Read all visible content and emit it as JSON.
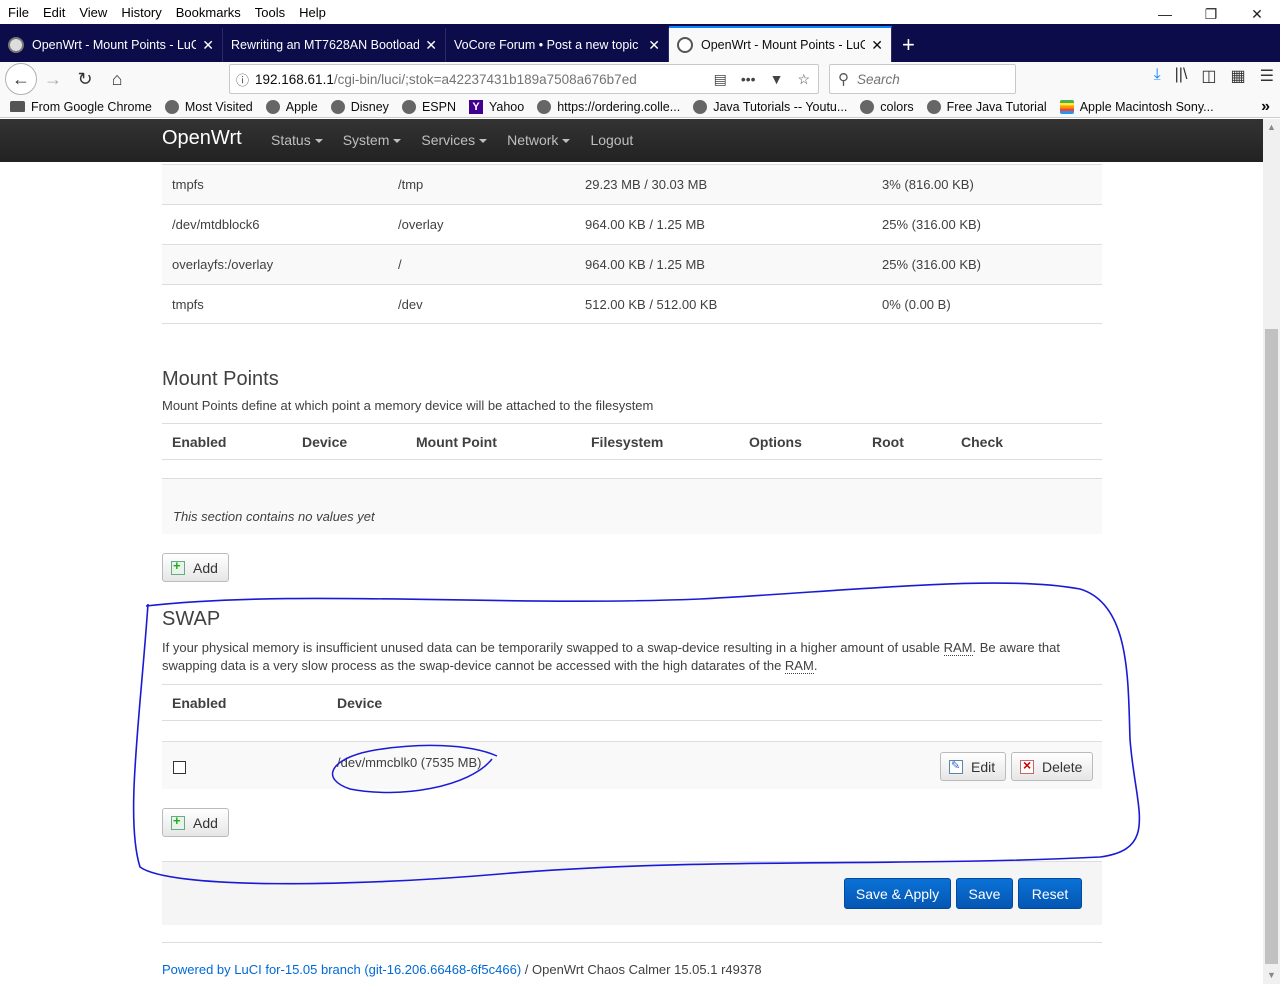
{
  "menubar": [
    "File",
    "Edit",
    "View",
    "History",
    "Bookmarks",
    "Tools",
    "Help"
  ],
  "tabs": [
    {
      "label": "OpenWrt - Mount Points - LuCI",
      "active": false
    },
    {
      "label": "Rewriting an MT7628AN Bootloader",
      "active": false
    },
    {
      "label": "VoCore Forum • Post a new topic",
      "active": false
    },
    {
      "label": "OpenWrt - Mount Points - LuCI",
      "active": true
    }
  ],
  "url": {
    "host": "192.168.61.1",
    "rest": "/cgi-bin/luci/;stok=a42237431b189a7508a676b7ed"
  },
  "search_placeholder": "Search",
  "bookmarks": [
    {
      "label": "From Google Chrome",
      "icon": "folder-icon"
    },
    {
      "label": "Most Visited",
      "icon": "gear-icon"
    },
    {
      "label": "Apple",
      "icon": "globe-icon"
    },
    {
      "label": "Disney",
      "icon": "globe-icon"
    },
    {
      "label": "ESPN",
      "icon": "globe-icon"
    },
    {
      "label": "Yahoo",
      "icon": "yahoo-icon"
    },
    {
      "label": "https://ordering.colle...",
      "icon": "globe-icon"
    },
    {
      "label": "Java Tutorials -- Youtu...",
      "icon": "globe-icon"
    },
    {
      "label": "colors",
      "icon": "globe-icon"
    },
    {
      "label": "Free Java Tutorial",
      "icon": "globe-icon"
    },
    {
      "label": "Apple Macintosh Sony...",
      "icon": "apple-icon"
    }
  ],
  "luci": {
    "brand": "OpenWrt",
    "nav": [
      "Status",
      "System",
      "Services",
      "Network",
      "Logout"
    ]
  },
  "mounted": [
    [
      "tmpfs",
      "/tmp",
      "29.23 MB / 30.03 MB",
      "3% (816.00 KB)"
    ],
    [
      "/dev/mtdblock6",
      "/overlay",
      "964.00 KB / 1.25 MB",
      "25% (316.00 KB)"
    ],
    [
      "overlayfs:/overlay",
      "/",
      "964.00 KB / 1.25 MB",
      "25% (316.00 KB)"
    ],
    [
      "tmpfs",
      "/dev",
      "512.00 KB / 512.00 KB",
      "0% (0.00 B)"
    ]
  ],
  "mount_points": {
    "title": "Mount Points",
    "desc": "Mount Points define at which point a memory device will be attached to the filesystem",
    "columns": [
      "Enabled",
      "Device",
      "Mount Point",
      "Filesystem",
      "Options",
      "Root",
      "Check"
    ],
    "empty": "This section contains no values yet",
    "add": "Add"
  },
  "swap": {
    "title": "SWAP",
    "desc1": "If your physical memory is insufficient unused data can be temporarily swapped to a swap-device resulting in a higher amount of usable ",
    "ram": "RAM",
    "desc2": ". Be aware that swapping data is a very slow process as the swap-device cannot be accessed with the high datarates of the ",
    "desc3": ".",
    "columns": [
      "Enabled",
      "Device"
    ],
    "device": "/dev/mmcblk0 (7535 MB)",
    "edit": "Edit",
    "delete": "Delete",
    "add": "Add"
  },
  "actions": {
    "save_apply": "Save & Apply",
    "save": "Save",
    "reset": "Reset"
  },
  "footer": {
    "link": "Powered by LuCI for-15.05 branch (git-16.206.66468-6f5c466)",
    "rest": " / OpenWrt Chaos Calmer 15.05.1 r49378"
  },
  "colors": {
    "annotation": "#1a1ad6",
    "primary_button": "#0a6fd1",
    "header": "#222222"
  }
}
